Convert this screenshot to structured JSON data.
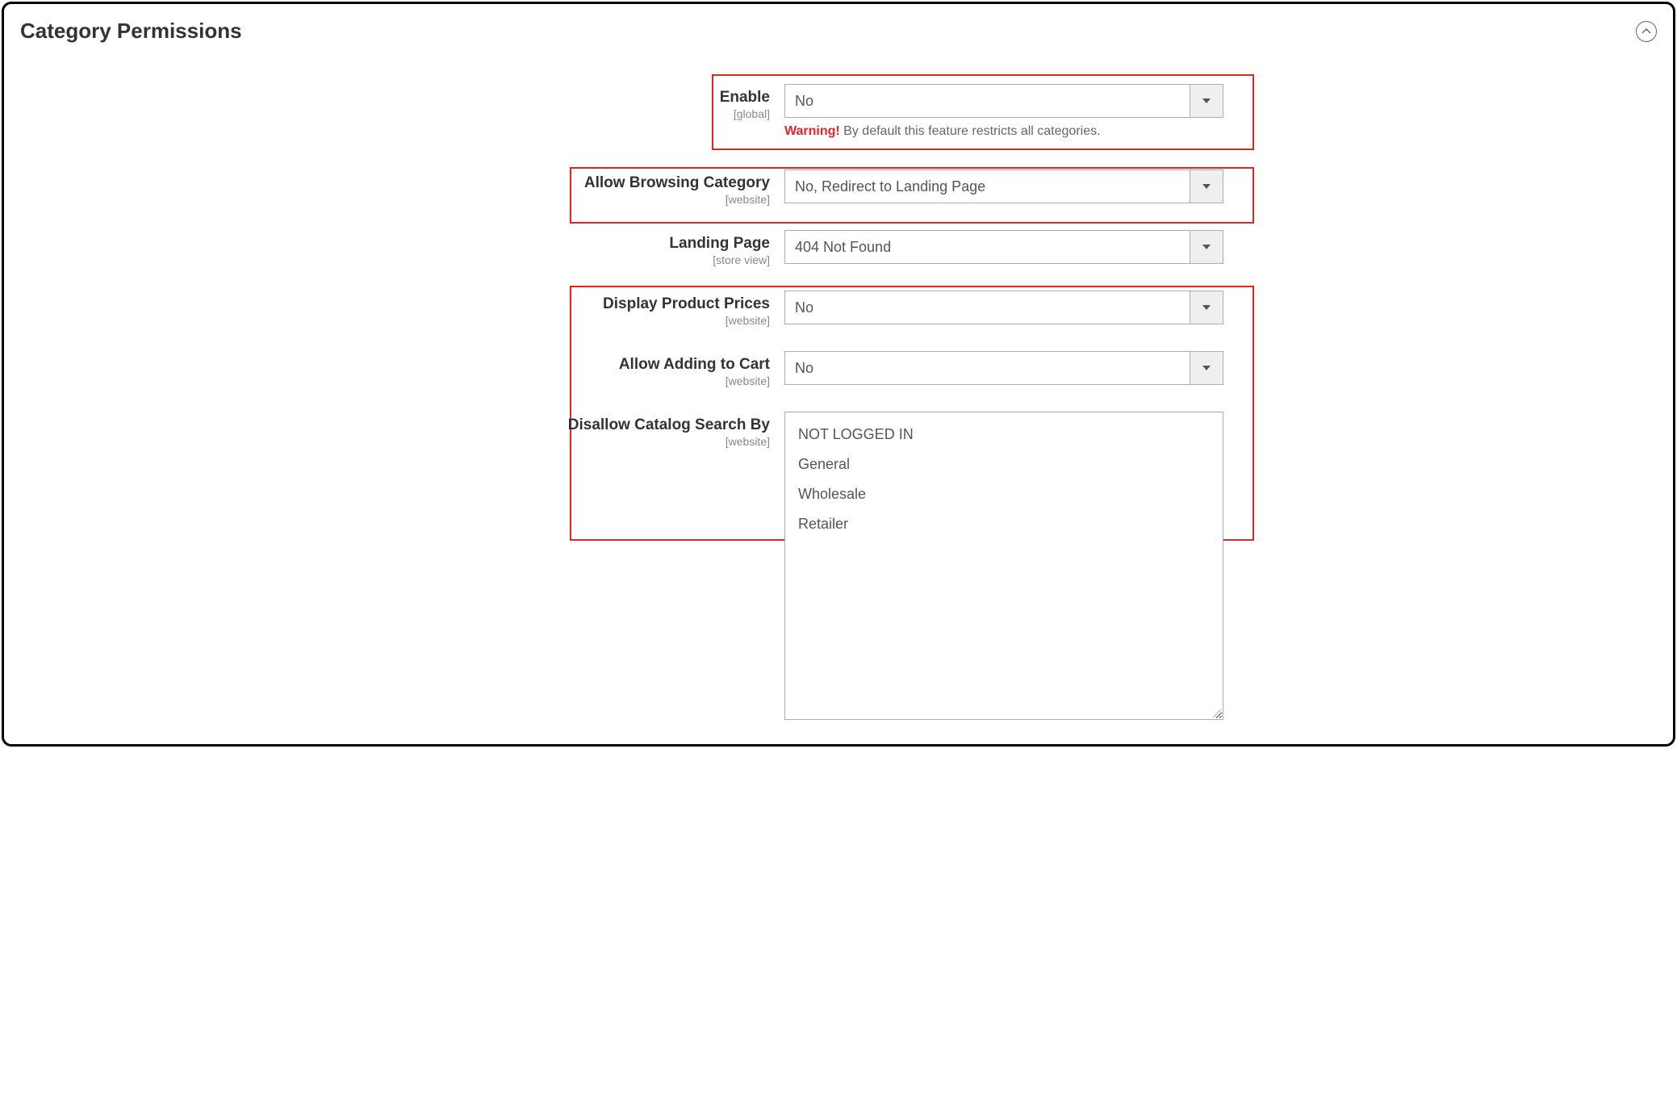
{
  "section": {
    "title": "Category Permissions"
  },
  "fields": {
    "enable": {
      "label": "Enable",
      "scope": "[global]",
      "value": "No",
      "warning_prefix": "Warning!",
      "warning_text": " By default this feature restricts all categories."
    },
    "allow_browsing": {
      "label": "Allow Browsing Category",
      "scope": "[website]",
      "value": "No, Redirect to Landing Page"
    },
    "landing_page": {
      "label": "Landing Page",
      "scope": "[store view]",
      "value": "404 Not Found"
    },
    "display_prices": {
      "label": "Display Product Prices",
      "scope": "[website]",
      "value": "No"
    },
    "allow_add_cart": {
      "label": "Allow Adding to Cart",
      "scope": "[website]",
      "value": "No"
    },
    "disallow_search": {
      "label": "Disallow Catalog Search By",
      "scope": "[website]",
      "options": [
        "NOT LOGGED IN",
        "General",
        "Wholesale",
        "Retailer"
      ]
    }
  }
}
